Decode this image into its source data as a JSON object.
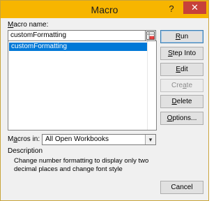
{
  "window": {
    "title": "Macro",
    "help_label": "?",
    "close_label": "✕"
  },
  "macro_name": {
    "label_underlined": "M",
    "label_rest": "acro name:",
    "value": "customFormatting"
  },
  "macro_list": {
    "items": [
      {
        "label": "customFormatting",
        "selected": true
      }
    ]
  },
  "buttons": {
    "run": {
      "u": "R",
      "rest": "un"
    },
    "step_into": {
      "u": "S",
      "rest": "tep Into"
    },
    "edit": {
      "u": "E",
      "rest": "dit"
    },
    "create": {
      "pre": "Cre",
      "u": "a",
      "rest": "te"
    },
    "delete": {
      "u": "D",
      "rest": "elete"
    },
    "options": {
      "u": "O",
      "rest": "ptions..."
    },
    "cancel": "Cancel"
  },
  "macros_in": {
    "label_pre": "M",
    "label_u": "a",
    "label_rest": "cros in:",
    "value": "All Open Workbooks"
  },
  "description": {
    "heading": "Description",
    "text": "Change number formatting to display only two decimal places and change font style"
  }
}
